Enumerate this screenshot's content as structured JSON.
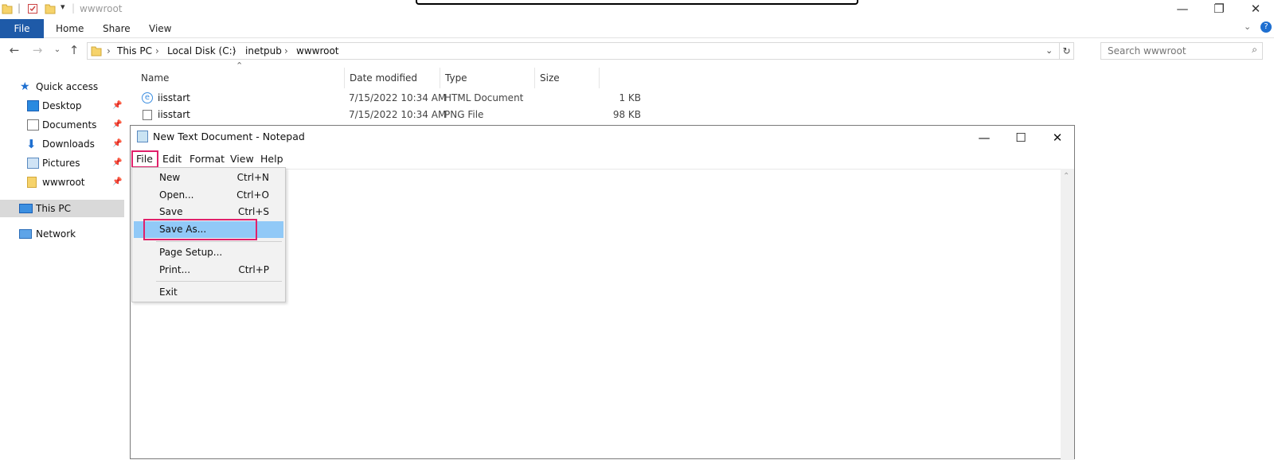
{
  "explorer": {
    "title": "wwwroot",
    "ribbon_tabs": [
      "File",
      "Home",
      "Share",
      "View"
    ],
    "breadcrumb": [
      "This PC",
      "Local Disk (C:)",
      "inetpub",
      "wwwroot"
    ],
    "search_placeholder": "Search wwwroot",
    "nav": {
      "quick_access": "Quick access",
      "items": [
        "Desktop",
        "Documents",
        "Downloads",
        "Pictures",
        "wwwroot"
      ],
      "this_pc": "This PC",
      "network": "Network"
    },
    "columns": [
      "Name",
      "Date modified",
      "Type",
      "Size"
    ],
    "files": [
      {
        "name": "iisstart",
        "date": "7/15/2022 10:34 AM",
        "type": "HTML Document",
        "size": "1 KB"
      },
      {
        "name": "iisstart",
        "date": "7/15/2022 10:34 AM",
        "type": "PNG File",
        "size": "98 KB"
      }
    ]
  },
  "notepad": {
    "title": "New Text Document - Notepad",
    "menu": [
      "File",
      "Edit",
      "Format",
      "View",
      "Help"
    ],
    "file_menu": [
      {
        "label": "New",
        "shortcut": "Ctrl+N"
      },
      {
        "label": "Open...",
        "shortcut": "Ctrl+O"
      },
      {
        "label": "Save",
        "shortcut": "Ctrl+S"
      },
      {
        "label": "Save As...",
        "shortcut": ""
      },
      {
        "label": "Page Setup...",
        "shortcut": ""
      },
      {
        "label": "Print...",
        "shortcut": "Ctrl+P"
      },
      {
        "label": "Exit",
        "shortcut": ""
      }
    ]
  },
  "colors": {
    "accent": "#1e5aa8",
    "highlight": "#e0206a",
    "menu_hover": "#91c9f7"
  }
}
